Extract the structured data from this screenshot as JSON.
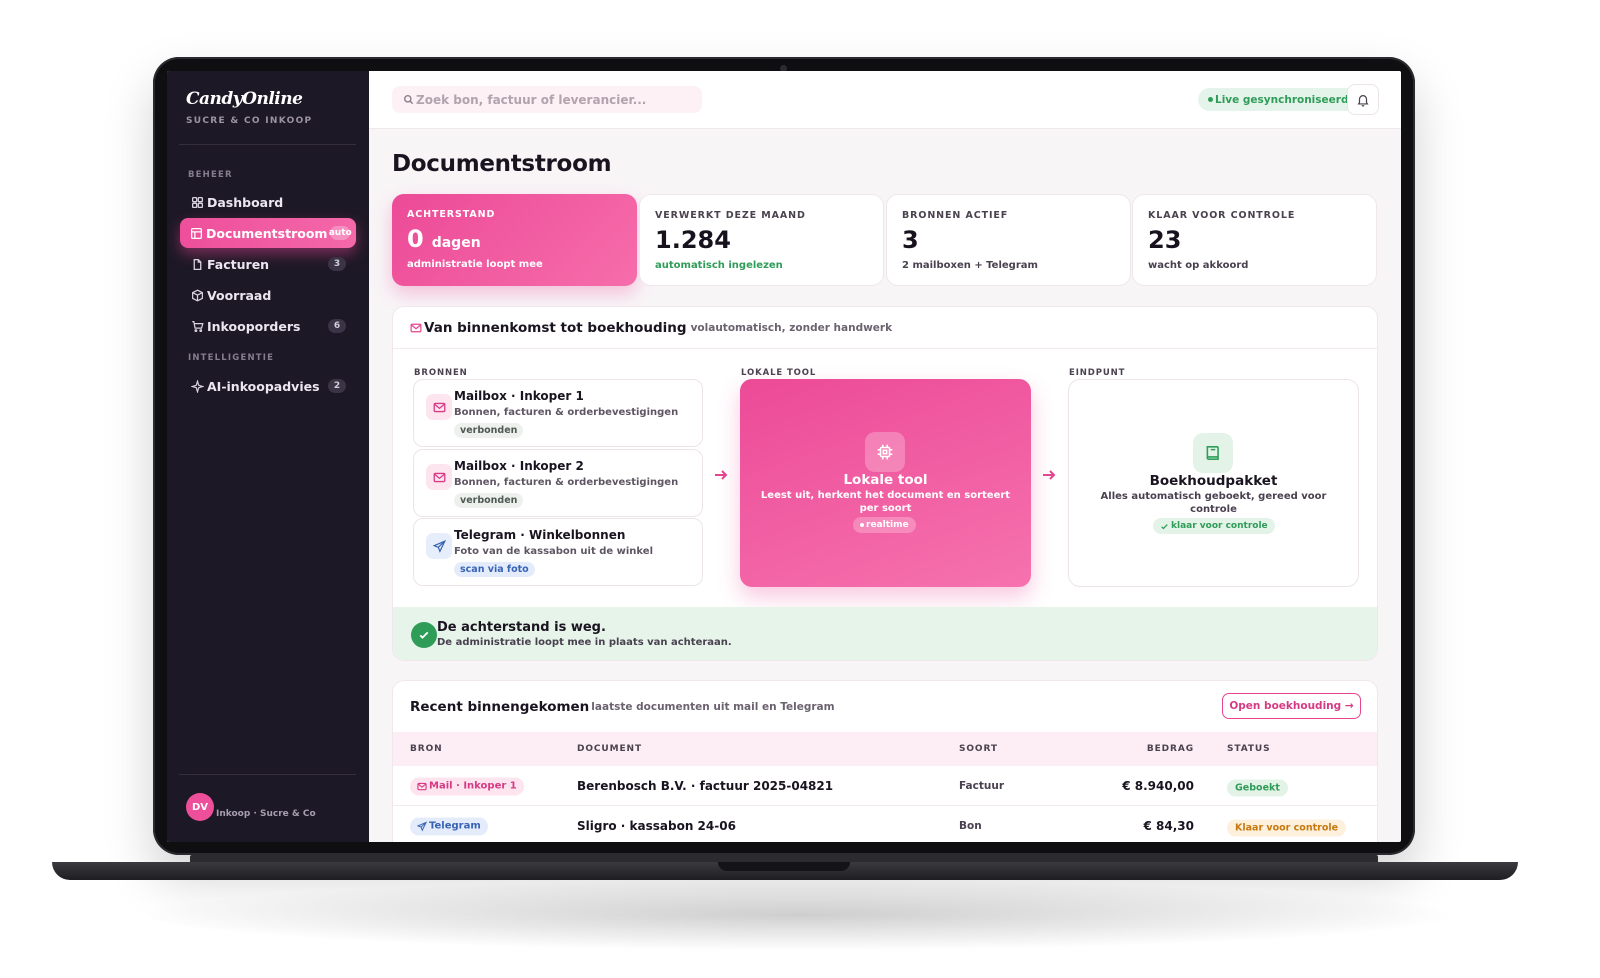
{
  "sidebar": {
    "brand": "CandyOnline",
    "brand_sub": "SUCRE & CO INKOOP",
    "section_beheer": "BEHEER",
    "section_intelligentie": "INTELLIGENTIE",
    "items": [
      {
        "label": "Dashboard",
        "icon": "dashboard-icon"
      },
      {
        "label": "Documentstroom",
        "icon": "layout-icon",
        "badge": "auto",
        "active": true
      },
      {
        "label": "Facturen",
        "icon": "file-icon",
        "badge": "3"
      },
      {
        "label": "Voorraad",
        "icon": "box-icon"
      },
      {
        "label": "Inkooporders",
        "icon": "cart-icon",
        "badge": "6"
      },
      {
        "label": "AI-inkoopadvies",
        "icon": "sparkle-icon",
        "badge": "2"
      }
    ],
    "user_initials": "DV",
    "user_name": "Inkoop · Sucre & Co"
  },
  "topbar": {
    "search_placeholder": "Zoek bon, factuur of leverancier...",
    "sync_status": "Live gesynchroniseerd"
  },
  "page": {
    "title": "Documentstroom"
  },
  "kpis": [
    {
      "label": "ACHTERSTAND",
      "value": "0",
      "unit": "dagen",
      "sub": "administratie loopt mee"
    },
    {
      "label": "VERWERKT DEZE MAAND",
      "value": "1.284",
      "sub": "automatisch ingelezen"
    },
    {
      "label": "BRONNEN ACTIEF",
      "value": "3",
      "sub": "2 mailboxen + Telegram"
    },
    {
      "label": "KLAAR VOOR CONTROLE",
      "value": "23",
      "sub": "wacht op akkoord"
    }
  ],
  "flow": {
    "title": "Van binnenkomst tot boekhouding",
    "subtitle": "volautomatisch, zonder handwerk",
    "col_sources": "BRONNEN",
    "col_tool": "LOKALE TOOL",
    "col_end": "EINDPUNT",
    "sources": [
      {
        "title": "Mailbox · Inkoper 1",
        "desc": "Bonnen, facturen & orderbevestigingen",
        "tag": "verbonden"
      },
      {
        "title": "Mailbox · Inkoper 2",
        "desc": "Bonnen, facturen & orderbevestigingen",
        "tag": "verbonden"
      },
      {
        "title": "Telegram · Winkelbonnen",
        "desc": "Foto van de kassabon uit de winkel",
        "tag": "scan via foto"
      }
    ],
    "tool": {
      "title": "Lokale tool",
      "desc": "Leest uit, herkent het document en sorteert per soort",
      "tag": "realtime"
    },
    "end": {
      "title": "Boekhoudpakket",
      "desc": "Alles automatisch geboekt, gereed voor controle",
      "tag": "klaar voor controle"
    },
    "success_title": "De achterstand is weg.",
    "success_sub": "De administratie loopt mee in plaats van achteraan."
  },
  "recent": {
    "title": "Recent binnengekomen",
    "subtitle": "laatste documenten uit mail en Telegram",
    "button": "Open boekhouding →",
    "columns": {
      "bron": "BRON",
      "document": "DOCUMENT",
      "soort": "SOORT",
      "bedrag": "BEDRAG",
      "status": "STATUS"
    },
    "rows": [
      {
        "bron": "Mail · Inkoper 1",
        "document": "Berenbosch B.V. · factuur 2025-04821",
        "soort": "Factuur",
        "bedrag": "€ 8.940,00",
        "status": "Geboekt"
      },
      {
        "bron": "Telegram",
        "document": "Sligro · kassabon 24-06",
        "soort": "Bon",
        "bedrag": "€ 84,30",
        "status": "Klaar voor controle"
      }
    ]
  },
  "colors": {
    "accent": "#ec4899",
    "sidebar_bg": "#1d1825",
    "success": "#2f9c58",
    "warning": "#c7780e"
  }
}
